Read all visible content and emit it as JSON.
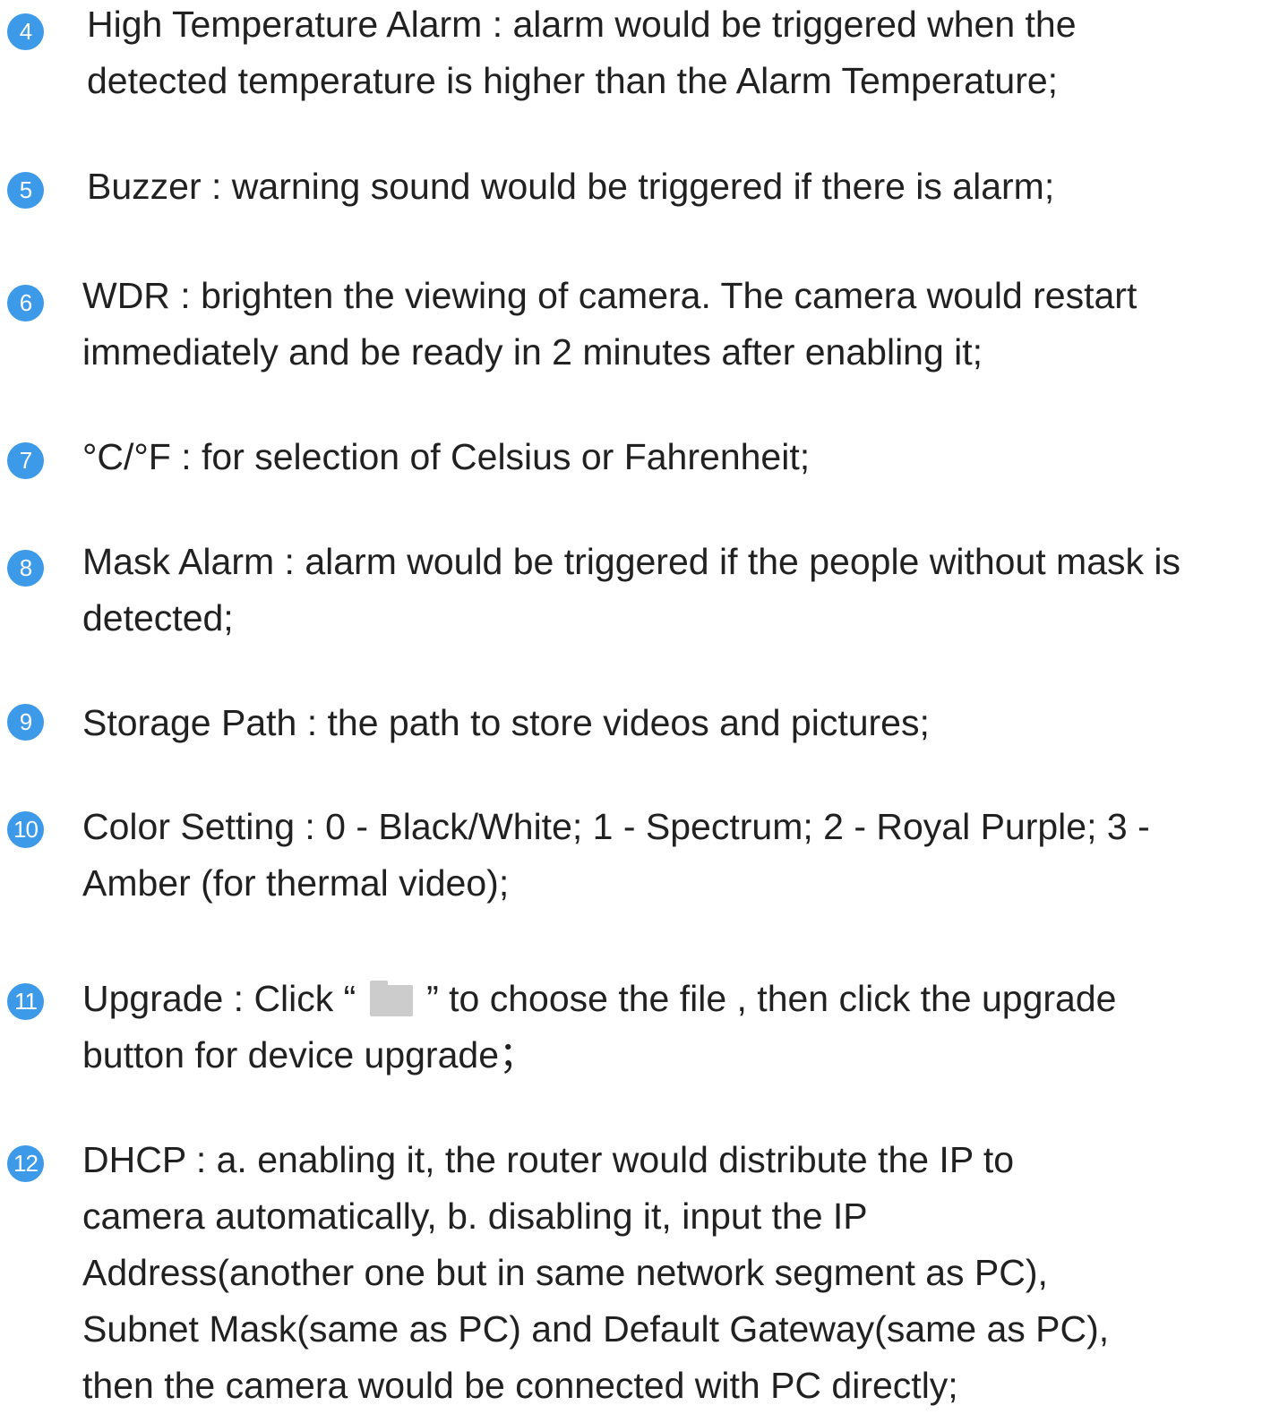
{
  "items": [
    {
      "number": "4",
      "lines": [
        "High Temperature Alarm : alarm would be triggered when the",
        "detected temperature is higher than the Alarm Temperature;"
      ]
    },
    {
      "number": "5",
      "lines": [
        "Buzzer : warning sound would be triggered if there is alarm;"
      ]
    },
    {
      "number": "6",
      "lines": [
        "WDR : brighten the viewing of camera. The camera would restart",
        "immediately and be ready in 2 minutes after enabling it;"
      ]
    },
    {
      "number": "7",
      "lines": [
        "°C/°F : for selection of Celsius or Fahrenheit;"
      ]
    },
    {
      "number": "8",
      "lines": [
        "Mask Alarm : alarm would be triggered if the people without mask is",
        "detected;"
      ]
    },
    {
      "number": "9",
      "lines": [
        "Storage Path : the path to store videos and pictures;"
      ]
    },
    {
      "number": "10",
      "lines": [
        "Color Setting : 0 - Black/White; 1 - Spectrum; 2 - Royal Purple; 3 -",
        "Amber (for thermal video);"
      ]
    },
    {
      "number": "11",
      "line1_before_icon": "Upgrade : Click “ ",
      "icon": "folder-icon",
      "line1_after_icon": " ” to choose the file , then click the upgrade",
      "lines": [
        "button for device upgrade；"
      ]
    },
    {
      "number": "12",
      "lines": [
        "DHCP : a. enabling it, the router would distribute the IP to",
        "camera automatically, b. disabling it, input the IP",
        "Address(another one but in same network segment as PC),",
        "Subnet Mask(same as PC) and Default Gateway(same as PC),",
        "then the camera would be connected with PC directly;"
      ]
    }
  ],
  "colors": {
    "badge": "#3d9ae8",
    "text": "#212121",
    "icon": "#cccccc"
  }
}
